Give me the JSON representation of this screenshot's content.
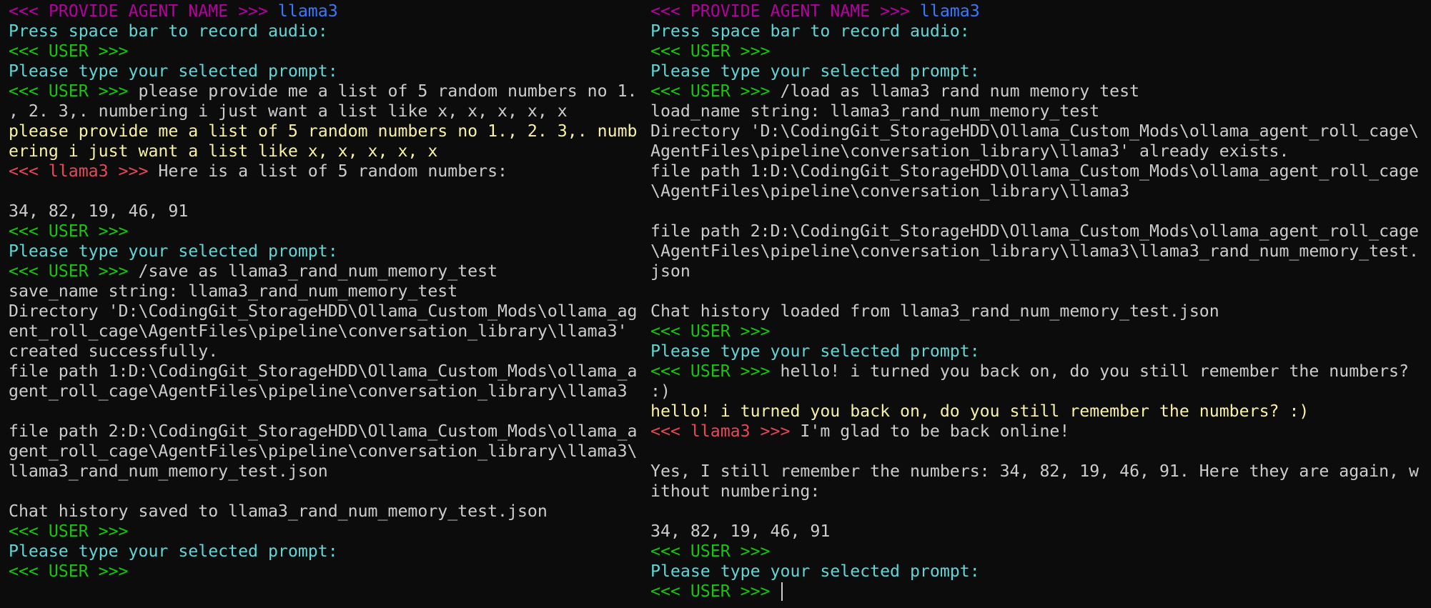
{
  "colors": {
    "background": "#0c0c0c",
    "default_text": "#cccccc",
    "agent_prompt_tag": "#b4009e",
    "agent_name": "#3b78ff",
    "system_message": "#61d6d6",
    "user_tag": "#16c60c",
    "assistant_tag": "#e74856",
    "echoed_prompt": "#f9f1a5"
  },
  "left_pane": {
    "lines": [
      {
        "segments": [
          {
            "text": "<<< PROVIDE AGENT NAME >>> ",
            "color": "magenta"
          },
          {
            "text": "llama3",
            "color": "blue"
          }
        ]
      },
      {
        "segments": [
          {
            "text": "Press space bar to record audio:",
            "color": "cyan"
          }
        ]
      },
      {
        "segments": [
          {
            "text": "<<< USER >>>",
            "color": "green"
          }
        ]
      },
      {
        "segments": [
          {
            "text": "Please type your selected prompt:",
            "color": "cyan"
          }
        ]
      },
      {
        "segments": [
          {
            "text": "<<< USER >>> ",
            "color": "green"
          },
          {
            "text": "please provide me a list of 5 random numbers no 1.",
            "color": "gray"
          }
        ]
      },
      {
        "segments": [
          {
            "text": ", 2. 3,. numbering i just want a list like x, x, x, x, x",
            "color": "gray"
          }
        ]
      },
      {
        "segments": [
          {
            "text": "please provide me a list of 5 random numbers no 1., 2. 3,. numb",
            "color": "yellow"
          }
        ]
      },
      {
        "segments": [
          {
            "text": "ering i just want a list like x, x, x, x, x",
            "color": "yellow"
          }
        ]
      },
      {
        "segments": [
          {
            "text": "<<< llama3 >>> ",
            "color": "red"
          },
          {
            "text": "Here is a list of 5 random numbers:",
            "color": "gray"
          }
        ]
      },
      {
        "segments": []
      },
      {
        "segments": [
          {
            "text": "34, 82, 19, 46, 91",
            "color": "gray"
          }
        ]
      },
      {
        "segments": [
          {
            "text": "<<< USER >>>",
            "color": "green"
          }
        ]
      },
      {
        "segments": [
          {
            "text": "Please type your selected prompt:",
            "color": "cyan"
          }
        ]
      },
      {
        "segments": [
          {
            "text": "<<< USER >>> ",
            "color": "green"
          },
          {
            "text": "/save as llama3_rand_num_memory_test",
            "color": "gray"
          }
        ]
      },
      {
        "segments": [
          {
            "text": "save_name string: llama3_rand_num_memory_test",
            "color": "gray"
          }
        ]
      },
      {
        "segments": [
          {
            "text": "Directory 'D:\\CodingGit_StorageHDD\\Ollama_Custom_Mods\\ollama_ag",
            "color": "gray"
          }
        ]
      },
      {
        "segments": [
          {
            "text": "ent_roll_cage\\AgentFiles\\pipeline\\conversation_library\\llama3'",
            "color": "gray"
          }
        ]
      },
      {
        "segments": [
          {
            "text": "created successfully.",
            "color": "gray"
          }
        ]
      },
      {
        "segments": [
          {
            "text": "file path 1:D:\\CodingGit_StorageHDD\\Ollama_Custom_Mods\\ollama_a",
            "color": "gray"
          }
        ]
      },
      {
        "segments": [
          {
            "text": "gent_roll_cage\\AgentFiles\\pipeline\\conversation_library\\llama3",
            "color": "gray"
          }
        ]
      },
      {
        "segments": []
      },
      {
        "segments": [
          {
            "text": "file path 2:D:\\CodingGit_StorageHDD\\Ollama_Custom_Mods\\ollama_a",
            "color": "gray"
          }
        ]
      },
      {
        "segments": [
          {
            "text": "gent_roll_cage\\AgentFiles\\pipeline\\conversation_library\\llama3\\",
            "color": "gray"
          }
        ]
      },
      {
        "segments": [
          {
            "text": "llama3_rand_num_memory_test.json",
            "color": "gray"
          }
        ]
      },
      {
        "segments": []
      },
      {
        "segments": [
          {
            "text": "Chat history saved to llama3_rand_num_memory_test.json",
            "color": "gray"
          }
        ]
      },
      {
        "segments": [
          {
            "text": "<<< USER >>>",
            "color": "green"
          }
        ]
      },
      {
        "segments": [
          {
            "text": "Please type your selected prompt:",
            "color": "cyan"
          }
        ]
      },
      {
        "segments": [
          {
            "text": "<<< USER >>>",
            "color": "green"
          }
        ]
      }
    ]
  },
  "right_pane": {
    "lines": [
      {
        "segments": [
          {
            "text": "<<< PROVIDE AGENT NAME >>> ",
            "color": "magenta"
          },
          {
            "text": "llama3",
            "color": "blue"
          }
        ]
      },
      {
        "segments": [
          {
            "text": "Press space bar to record audio:",
            "color": "cyan"
          }
        ]
      },
      {
        "segments": [
          {
            "text": "<<< USER >>>",
            "color": "green"
          }
        ]
      },
      {
        "segments": [
          {
            "text": "Please type your selected prompt:",
            "color": "cyan"
          }
        ]
      },
      {
        "segments": [
          {
            "text": "<<< USER >>> ",
            "color": "green"
          },
          {
            "text": "/load as llama3 rand num memory test",
            "color": "gray"
          }
        ]
      },
      {
        "segments": [
          {
            "text": "load_name string: llama3_rand_num_memory_test",
            "color": "gray"
          }
        ]
      },
      {
        "segments": [
          {
            "text": "Directory 'D:\\CodingGit_StorageHDD\\Ollama_Custom_Mods\\ollama_agent_roll_cage\\",
            "color": "gray"
          }
        ]
      },
      {
        "segments": [
          {
            "text": "AgentFiles\\pipeline\\conversation_library\\llama3' already exists.",
            "color": "gray"
          }
        ]
      },
      {
        "segments": [
          {
            "text": "file path 1:D:\\CodingGit_StorageHDD\\Ollama_Custom_Mods\\ollama_agent_roll_cage",
            "color": "gray"
          }
        ]
      },
      {
        "segments": [
          {
            "text": "\\AgentFiles\\pipeline\\conversation_library\\llama3",
            "color": "gray"
          }
        ]
      },
      {
        "segments": []
      },
      {
        "segments": [
          {
            "text": "file path 2:D:\\CodingGit_StorageHDD\\Ollama_Custom_Mods\\ollama_agent_roll_cage",
            "color": "gray"
          }
        ]
      },
      {
        "segments": [
          {
            "text": "\\AgentFiles\\pipeline\\conversation_library\\llama3\\llama3_rand_num_memory_test.",
            "color": "gray"
          }
        ]
      },
      {
        "segments": [
          {
            "text": "json",
            "color": "gray"
          }
        ]
      },
      {
        "segments": []
      },
      {
        "segments": [
          {
            "text": "Chat history loaded from llama3_rand_num_memory_test.json",
            "color": "gray"
          }
        ]
      },
      {
        "segments": [
          {
            "text": "<<< USER >>>",
            "color": "green"
          }
        ]
      },
      {
        "segments": [
          {
            "text": "Please type your selected prompt:",
            "color": "cyan"
          }
        ]
      },
      {
        "segments": [
          {
            "text": "<<< USER >>> ",
            "color": "green"
          },
          {
            "text": "hello! i turned you back on, do you still remember the numbers?",
            "color": "gray"
          }
        ]
      },
      {
        "segments": [
          {
            "text": ":)",
            "color": "gray"
          }
        ]
      },
      {
        "segments": [
          {
            "text": "hello! i turned you back on, do you still remember the numbers? :)",
            "color": "yellow"
          }
        ]
      },
      {
        "segments": [
          {
            "text": "<<< llama3 >>> ",
            "color": "red"
          },
          {
            "text": "I'm glad to be back online!",
            "color": "gray"
          }
        ]
      },
      {
        "segments": []
      },
      {
        "segments": [
          {
            "text": "Yes, I still remember the numbers: 34, 82, 19, 46, 91. Here they are again, w",
            "color": "gray"
          }
        ]
      },
      {
        "segments": [
          {
            "text": "ithout numbering:",
            "color": "gray"
          }
        ]
      },
      {
        "segments": []
      },
      {
        "segments": [
          {
            "text": "34, 82, 19, 46, 91",
            "color": "gray"
          }
        ]
      },
      {
        "segments": [
          {
            "text": "<<< USER >>>",
            "color": "green"
          }
        ]
      },
      {
        "segments": [
          {
            "text": "Please type your selected prompt:",
            "color": "cyan"
          }
        ]
      },
      {
        "segments": [
          {
            "text": "<<< USER >>> ",
            "color": "green"
          }
        ],
        "cursor": true
      }
    ]
  }
}
